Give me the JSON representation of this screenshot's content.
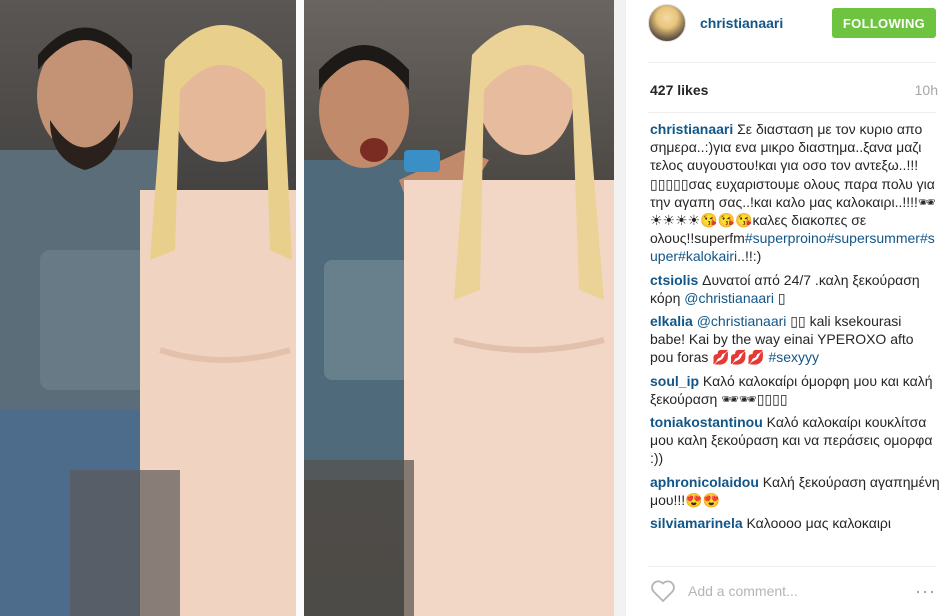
{
  "post": {
    "username": "christianaari",
    "follow_label": "FOLLOWING",
    "likes": "427 likes",
    "time": "10h",
    "add_comment_placeholder": "Add a comment...",
    "more_label": "···"
  },
  "comments": [
    {
      "user": "christianaari",
      "parts": [
        {
          "t": "Σε διασταση με τον κυριο απο σημερα..:)για ενα μικρο διαστημα..ξανα μαζι τελος αυγουστου!και για οσο τον αντεξω..!!!▯▯▯▯▯σας ευχαριστουμε ολους παρα πολυ για την αγαπη σας..!και καλο μας καλοκαιρι..!!!!🕶☀☀☀☀😘😘😘καλες διακοπες σε ολους!!superfm"
        },
        {
          "t": "#superproino",
          "tag": true
        },
        {
          "t": "#supersummer",
          "tag": true
        },
        {
          "t": "#super",
          "tag": true
        },
        {
          "t": "#kalokairi",
          "tag": true
        },
        {
          "t": "..!!:)"
        }
      ]
    },
    {
      "user": "ctsiolis",
      "parts": [
        {
          "t": "Δυνατοί από 24/7 .καλη ξεκούραση κόρη "
        },
        {
          "t": "@christianaari",
          "tag": true
        },
        {
          "t": " ▯"
        }
      ]
    },
    {
      "user": "elkalia",
      "parts": [
        {
          "t": "@christianaari",
          "tag": true
        },
        {
          "t": " ▯▯ kali ksekourasi babe! Kai by the way einai YPEROXO afto pou foras 💋💋💋 "
        },
        {
          "t": "#sexyyy",
          "tag": true
        }
      ]
    },
    {
      "user": "soul_ip",
      "parts": [
        {
          "t": "Καλό καλοκαίρι όμορφη μου και καλή ξεκούραση 🕶🕶▯▯▯▯"
        }
      ]
    },
    {
      "user": "toniakostantinou",
      "parts": [
        {
          "t": "Καλό καλοκαίρι κουκλίτσα μου καλη ξεκούραση και να περάσεις ομορφα :))"
        }
      ]
    },
    {
      "user": "aphronicolaidou",
      "parts": [
        {
          "t": "Καλή ξεκούραση αγαπημένη μου!!!😍😍"
        }
      ]
    },
    {
      "user": "silviamarinela",
      "parts": [
        {
          "t": "Καλοοοο μας καλοκαιρι"
        }
      ]
    }
  ],
  "colors": {
    "accent_blue": "#125688",
    "follow_green": "#6ec340",
    "muted_gray": "#a5a7aa"
  }
}
